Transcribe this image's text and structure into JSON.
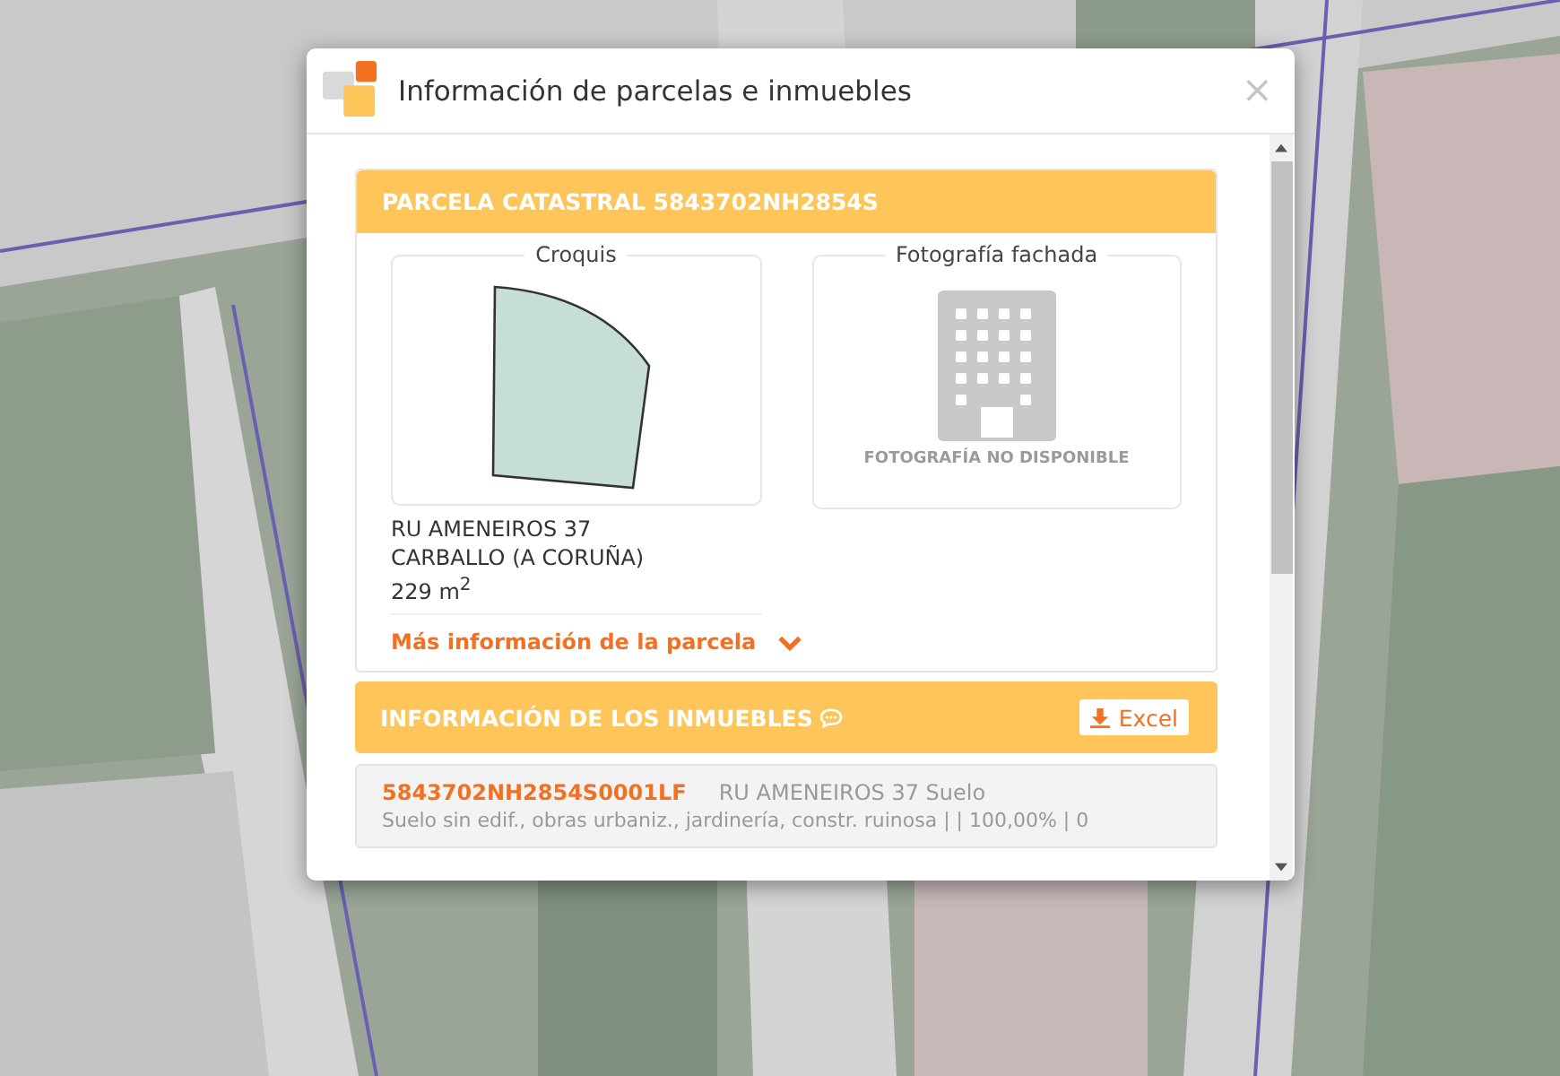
{
  "window": {
    "title": "Información de parcelas e inmuebles",
    "close": "×"
  },
  "parcel": {
    "title": "PARCELA CATASTRAL 5843702NH2854S",
    "sketch_label": "Croquis",
    "photo_label": "Fotografía fachada",
    "photo_placeholder": "FOTOGRAFÍA NO DISPONIBLE",
    "address_lines": [
      "RU AMENEIROS 37",
      "CARBALLO (A CORUÑA)",
      "229 m$^{2}$"
    ],
    "more_link": "Más información de la parcela",
    "expanded": false
  },
  "properties": {
    "title": "INFORMACIÓN DE LOS INMUEBLES",
    "export_button": "Excel",
    "items": [
      {
        "reference": "5843702NH2854S0001LF",
        "address": "RU AMENEIROS 37 Suelo",
        "details": "Suelo sin edif., obras urbaniz., jardinería, constr. ruinosa | | 100,00% | 0"
      }
    ]
  }
}
